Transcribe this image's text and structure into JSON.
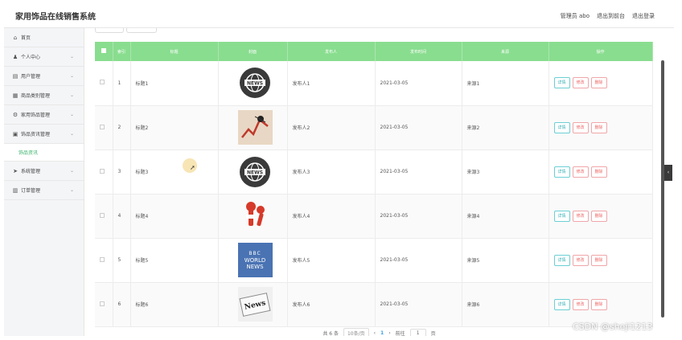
{
  "header": {
    "title": "家用饰品在线销售系统",
    "admin": "管理员 abo",
    "back_front": "退出到前台",
    "logout": "退出登录"
  },
  "sidebar": {
    "items": [
      {
        "icon": "home-icon",
        "glyph": "⌂",
        "label": "首页",
        "chevron": false
      },
      {
        "icon": "user-icon",
        "glyph": "♟",
        "label": "个人中心",
        "chevron": true
      },
      {
        "icon": "users-icon",
        "glyph": "▤",
        "label": "用户管理",
        "chevron": true
      },
      {
        "icon": "category-icon",
        "glyph": "▦",
        "label": "商品类别管理",
        "chevron": true
      },
      {
        "icon": "settings-icon",
        "glyph": "⚙",
        "label": "家用饰品管理",
        "chevron": true
      },
      {
        "icon": "news-icon",
        "glyph": "▣",
        "label": "饰品资讯管理",
        "chevron": true
      }
    ],
    "sub_item": "饰品资讯",
    "items_after": [
      {
        "icon": "send-icon",
        "glyph": "➤",
        "label": "系统管理",
        "chevron": true
      },
      {
        "icon": "order-icon",
        "glyph": "▥",
        "label": "订单管理",
        "chevron": true
      }
    ]
  },
  "table": {
    "columns": [
      "索引",
      "标题",
      "封面",
      "发布人",
      "发布时间",
      "来源",
      "操作"
    ],
    "rows": [
      {
        "index": "1",
        "title": "标题1",
        "cover": "news-globe",
        "publisher": "发布人1",
        "time": "2021-03-05",
        "source": "来源1"
      },
      {
        "index": "2",
        "title": "标题2",
        "cover": "news-chart",
        "publisher": "发布人2",
        "time": "2021-03-05",
        "source": "来源2"
      },
      {
        "index": "3",
        "title": "标题3",
        "cover": "news-globe",
        "publisher": "发布人3",
        "time": "2021-03-05",
        "source": "来源3"
      },
      {
        "index": "4",
        "title": "标题4",
        "cover": "news-mic",
        "publisher": "发布人4",
        "time": "2021-03-05",
        "source": "来源4"
      },
      {
        "index": "5",
        "title": "标题5",
        "cover": "news-bbc",
        "publisher": "发布人5",
        "time": "2021-03-05",
        "source": "来源5"
      },
      {
        "index": "6",
        "title": "标题6",
        "cover": "news-paper",
        "publisher": "发布人6",
        "time": "2021-03-05",
        "source": "来源6"
      }
    ],
    "actions": {
      "detail": "详情",
      "edit": "修改",
      "delete": "删除"
    }
  },
  "cover_text": {
    "globe": "NEWS",
    "bbc_logo": "BBC",
    "bbc_world": "WORLD",
    "bbc_news": "NEWS",
    "paper": "News"
  },
  "pagination": {
    "total": "共 6 条",
    "page_size": "10条/页",
    "prev": "‹",
    "current": "1",
    "next": "›",
    "goto_label": "前往",
    "goto_value": "1",
    "page_unit": "页"
  },
  "watermark": "CSDN @sheji1213"
}
